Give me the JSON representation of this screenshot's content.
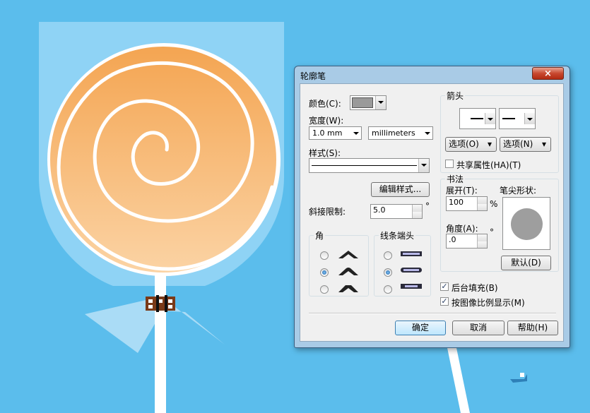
{
  "dialog": {
    "title": "轮廓笔",
    "close_glyph": "×",
    "color_label": "颜色(C):",
    "color_value": "#9a9a9a",
    "width_label": "宽度(W):",
    "width_value": "1.0 mm",
    "unit_value": "millimeters",
    "style_label": "样式(S):",
    "edit_style_label": "编辑样式...",
    "miter_label": "斜接限制:",
    "miter_value": "5.0",
    "miter_unit": "°",
    "corner_group": "角",
    "linecap_group": "线条端头",
    "arrow_group": "箭头",
    "arrow_options_left": "选项(O)",
    "arrow_options_right": "选项(N)",
    "shared_attrs": "共享属性(HA)(T)",
    "calligraphy_group": "书法",
    "stretch_label": "展开(T):",
    "stretch_value": "100",
    "stretch_unit": "%",
    "angle_label": "角度(A):",
    "angle_value": ".0",
    "angle_unit": "°",
    "nib_label": "笔尖形状:",
    "default_label": "默认(D)",
    "behind_fill": "后台填充(B)",
    "scale_with_image": "按图像比例显示(M)",
    "ok_label": "确定",
    "cancel_label": "取消",
    "help_label": "帮助(H)",
    "corner_selected": 1,
    "linecap_selected": 1,
    "behind_fill_checked": true,
    "scale_checked": true,
    "shared_checked": false
  },
  "colors": {
    "background": "#5bbdec",
    "cup": "#8fd3f5",
    "candy_top": "#f4a552",
    "candy_bottom": "#fbd3a4",
    "spiral": "#ffffff"
  }
}
